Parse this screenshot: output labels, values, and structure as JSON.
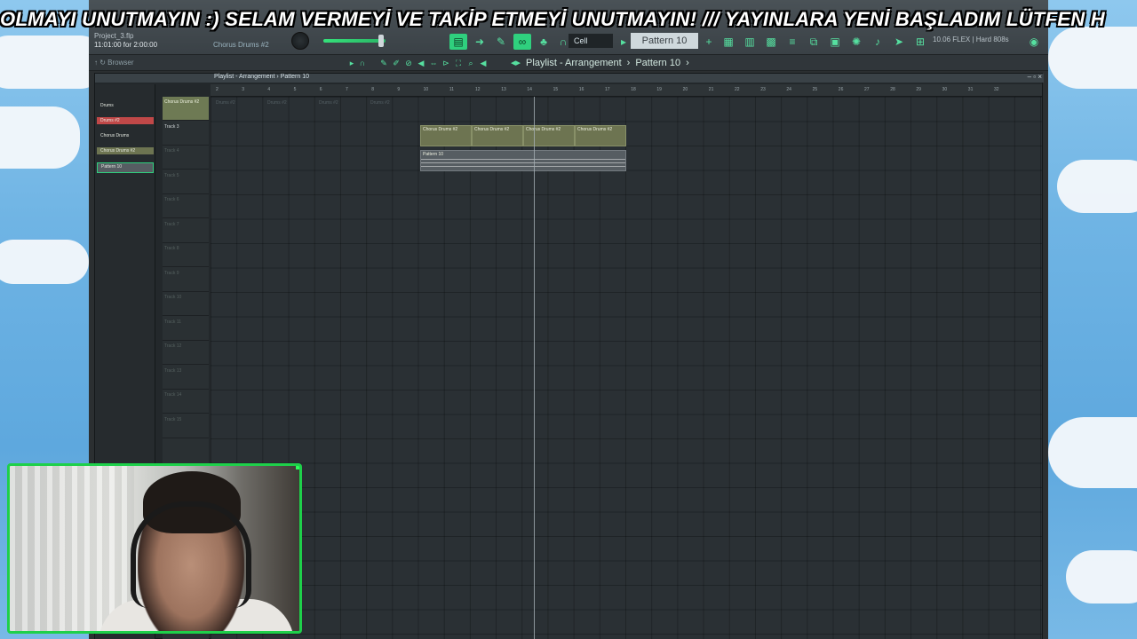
{
  "ticker": {
    "text": "OLMAYI UNUTMAYIN :)     SELAM VERMEYİ VE TAKİP ETMEYİ UNUTMAYIN!   ///  YAYINLARA YENİ BAŞLADIM LÜTFEN H"
  },
  "fl": {
    "project_name": "Project_3.flp",
    "time_status": "11:01:00 for 2:00:00",
    "hint_text": "Chorus Drums #2",
    "snap_value": "Cell",
    "pattern_selector": "Pattern 10",
    "cpu_info": "10.06  FLEX | Hard 808s",
    "browser_label": "Browser",
    "breadcrumb": {
      "playlist": "Playlist - Arrangement",
      "pattern": "Pattern 10"
    },
    "playlist_title": "Playlist - Arrangement › Pattern 10",
    "pattern_list": [
      "Drums",
      "Drums #2",
      "Chorus Drums",
      "Chorus Drums #2",
      "Pattern 10"
    ],
    "tracks": [
      {
        "name": "Chorus Drums #2"
      },
      {
        "name": "Track 3"
      },
      {
        "name": "Track 4"
      },
      {
        "name": "Track 5"
      },
      {
        "name": "Track 6"
      },
      {
        "name": "Track 7"
      },
      {
        "name": "Track 8"
      },
      {
        "name": "Track 9"
      },
      {
        "name": "Track 10"
      },
      {
        "name": "Track 11"
      },
      {
        "name": "Track 12"
      },
      {
        "name": "Track 13"
      },
      {
        "name": "Track 14"
      },
      {
        "name": "Track 15"
      }
    ],
    "timeline_numbers": [
      "2",
      "3",
      "4",
      "5",
      "6",
      "7",
      "8",
      "9",
      "10",
      "11",
      "12",
      "13",
      "14",
      "15",
      "16",
      "17",
      "18",
      "19",
      "20",
      "21",
      "22",
      "23",
      "24",
      "25",
      "26",
      "27",
      "28",
      "29",
      "30",
      "31",
      "32"
    ],
    "clips": [
      {
        "label": "Chorus Drums #2"
      },
      {
        "label": "Chorus Drums #2"
      },
      {
        "label": "Chorus Drums #2"
      },
      {
        "label": "Chorus Drums #2"
      }
    ],
    "pattern_clip_label": "Pattern 10",
    "ghost_clips": [
      "Drums #2",
      "Drums #2",
      "Drums #2",
      "Drums #2"
    ]
  },
  "colors": {
    "accent": "#2fd07e",
    "clip": "#6d7451",
    "webcam_border": "#1ed04a"
  }
}
